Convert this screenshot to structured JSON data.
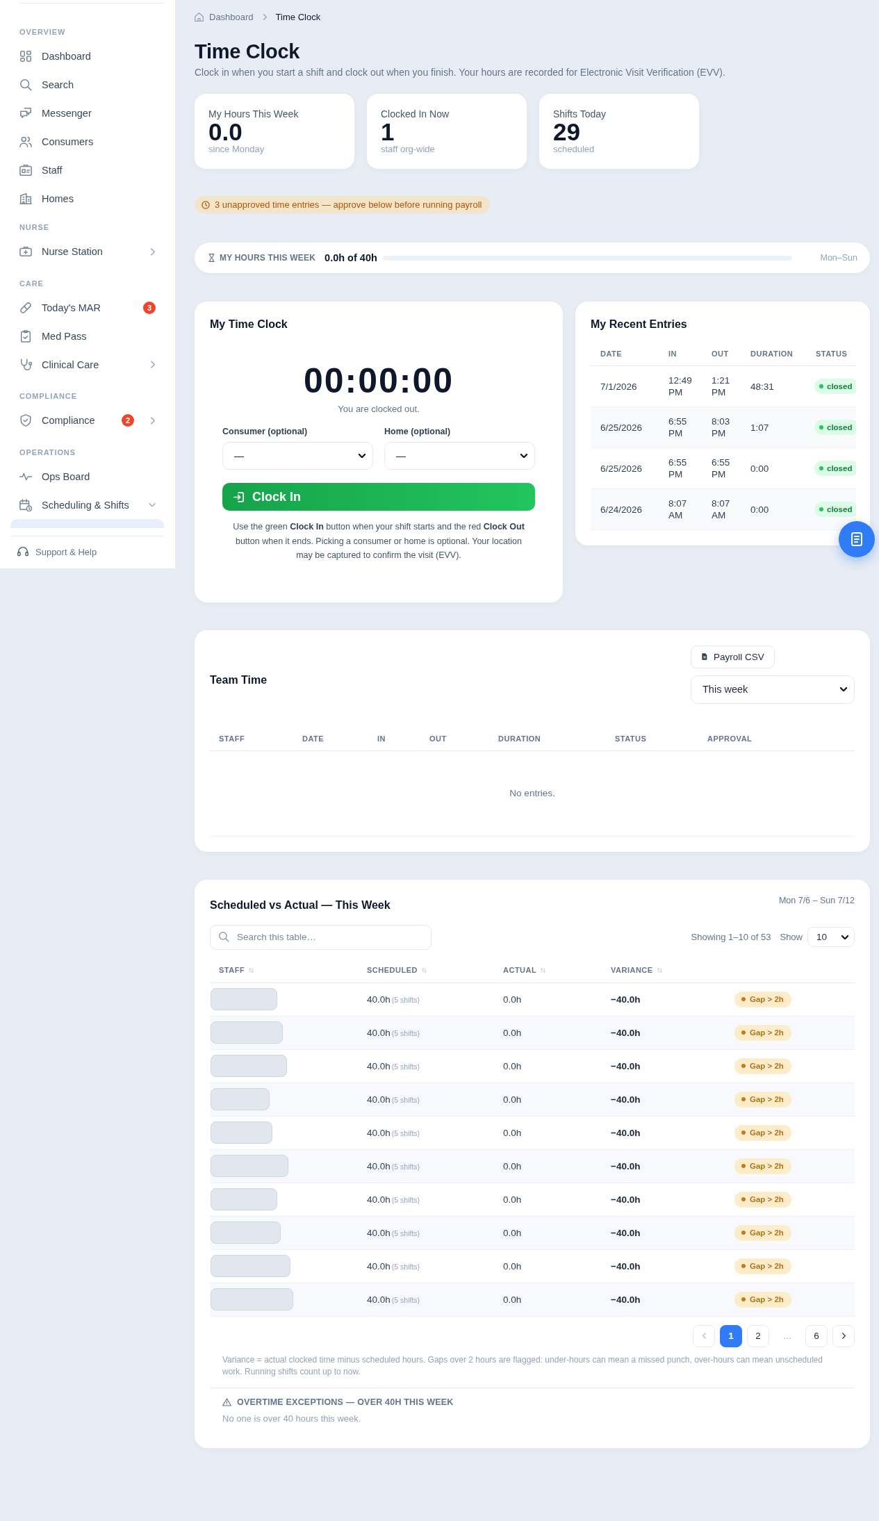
{
  "sidebar": {
    "sections": [
      {
        "heading": "OVERVIEW",
        "items": [
          {
            "label": "Dashboard",
            "selected": false
          },
          {
            "label": "Search",
            "selected": false
          },
          {
            "label": "Messenger",
            "selected": false
          },
          {
            "label": "Consumers",
            "selected": false
          },
          {
            "label": "Staff",
            "selected": false
          },
          {
            "label": "Homes",
            "selected": false
          }
        ]
      },
      {
        "heading": "NURSE",
        "items": [
          {
            "label": "Nurse Station",
            "selected": false,
            "expanded": false
          }
        ]
      },
      {
        "heading": "CARE",
        "items": [
          {
            "label": "Today's MAR",
            "selected": false,
            "badge": "3"
          },
          {
            "label": "Med Pass",
            "selected": false
          },
          {
            "label": "Clinical Care",
            "selected": false,
            "expanded": false
          }
        ]
      },
      {
        "heading": "COMPLIANCE",
        "items": [
          {
            "label": "Compliance",
            "selected": false,
            "badge": "2",
            "expanded": false
          }
        ]
      },
      {
        "heading": "OPERATIONS",
        "items": [
          {
            "label": "Ops Board",
            "selected": false
          },
          {
            "label": "Scheduling & Shifts",
            "selected": false,
            "expanded": true
          }
        ]
      }
    ],
    "clipped_item": {
      "selected": true
    },
    "footer": {
      "label": "Support & Help"
    }
  },
  "breadcrumb": [
    {
      "label": "Dashboard",
      "kind": "link"
    },
    {
      "label": "Time Clock",
      "kind": "current"
    }
  ],
  "page": {
    "title": "Time Clock",
    "subtitle": "Clock in when you start a shift and clock out when you finish. Your hours are recorded for Electronic Visit Verification (EVV)."
  },
  "stats": [
    {
      "label": "My Hours This Week",
      "value": "0.0",
      "caption": "since Monday"
    },
    {
      "label": "Clocked In Now",
      "value": "1",
      "caption": "staff org-wide"
    },
    {
      "label": "Shifts Today",
      "value": "29",
      "caption": "scheduled"
    }
  ],
  "alert": {
    "text": "3 unapproved time entries — approve below before running payroll"
  },
  "hours_bar": {
    "label": "MY HOURS THIS WEEK",
    "value": "0.0h of 40h",
    "level": 0,
    "range": "Mon–Sun"
  },
  "time_clock": {
    "title": "My Time Clock",
    "timer": "00:00:00",
    "status": "You are clocked out.",
    "fields": [
      {
        "label": "Consumer (optional)",
        "value": "—"
      },
      {
        "label": "Home (optional)",
        "value": "—"
      }
    ],
    "button": "Clock In",
    "help": "Use the green **Clock In** button when your shift starts and the red **Clock Out** button when it ends. Picking a consumer or home is optional. Your location may be captured to confirm the visit (EVV)."
  },
  "recent_entries": {
    "title": "My Recent Entries",
    "columns": [
      "DATE",
      "IN",
      "OUT",
      "DURATION",
      "STATUS"
    ],
    "rows": [
      {
        "date": "7/1/2026",
        "in": "12:49 PM",
        "out": "1:21 PM",
        "duration": "48:31",
        "status": "closed"
      },
      {
        "date": "6/25/2026",
        "in": "6:55 PM",
        "out": "8:03 PM",
        "duration": "1:07",
        "status": "closed"
      },
      {
        "date": "6/25/2026",
        "in": "6:55 PM",
        "out": "6:55 PM",
        "duration": "0:00",
        "status": "closed"
      },
      {
        "date": "6/24/2026",
        "in": "8:07 AM",
        "out": "8:07 AM",
        "duration": "0:00",
        "status": "closed"
      }
    ]
  },
  "team_time": {
    "title": "Team Time",
    "export_button": "Payroll CSV",
    "period": "This week",
    "columns": [
      "STAFF",
      "DATE",
      "IN",
      "OUT",
      "DURATION",
      "STATUS",
      "APPROVAL"
    ],
    "empty_text": "No entries."
  },
  "schedule": {
    "title": "Scheduled vs Actual — This Week",
    "date_range": "Mon 7/6 – Sun 7/12",
    "search": {
      "placeholder": "Search this table…"
    },
    "showing": "Showing 1–10 of 53",
    "show_label": "Show",
    "page_size": "10",
    "columns": [
      "STAFF",
      "SCHEDULED",
      "ACTUAL",
      "VARIANCE"
    ],
    "rows": [
      {
        "scheduled": "40.0h",
        "shifts": "(5 shifts)",
        "actual": "0.0h",
        "variance": "−40.0h",
        "flag": "Gap > 2h"
      },
      {
        "scheduled": "40.0h",
        "shifts": "(5 shifts)",
        "actual": "0.0h",
        "variance": "−40.0h",
        "flag": "Gap > 2h"
      },
      {
        "scheduled": "40.0h",
        "shifts": "(5 shifts)",
        "actual": "0.0h",
        "variance": "−40.0h",
        "flag": "Gap > 2h"
      },
      {
        "scheduled": "40.0h",
        "shifts": "(5 shifts)",
        "actual": "0.0h",
        "variance": "−40.0h",
        "flag": "Gap > 2h"
      },
      {
        "scheduled": "40.0h",
        "shifts": "(5 shifts)",
        "actual": "0.0h",
        "variance": "−40.0h",
        "flag": "Gap > 2h"
      },
      {
        "scheduled": "40.0h",
        "shifts": "(5 shifts)",
        "actual": "0.0h",
        "variance": "−40.0h",
        "flag": "Gap > 2h"
      },
      {
        "scheduled": "40.0h",
        "shifts": "(5 shifts)",
        "actual": "0.0h",
        "variance": "−40.0h",
        "flag": "Gap > 2h"
      },
      {
        "scheduled": "40.0h",
        "shifts": "(5 shifts)",
        "actual": "0.0h",
        "variance": "−40.0h",
        "flag": "Gap > 2h"
      },
      {
        "scheduled": "40.0h",
        "shifts": "(5 shifts)",
        "actual": "0.0h",
        "variance": "−40.0h",
        "flag": "Gap > 2h"
      },
      {
        "scheduled": "40.0h",
        "shifts": "(5 shifts)",
        "actual": "0.0h",
        "variance": "−40.0h",
        "flag": "Gap > 2h"
      }
    ],
    "pagination": {
      "pages": [
        {
          "kind": "page",
          "label": "1",
          "selected": true
        },
        {
          "kind": "page",
          "label": "2",
          "selected": false
        },
        {
          "kind": "ellipsis",
          "label": "…"
        },
        {
          "kind": "page",
          "label": "6",
          "selected": false
        }
      ]
    },
    "note": "Variance = actual clocked time minus scheduled hours. Gaps over 2 hours are flagged: under-hours can mean a missed punch, over-hours can mean unscheduled work. Running shifts count up to now.",
    "overtime": {
      "title": "OVERTIME EXCEPTIONS — OVER 40H THIS WEEK",
      "text": "No one is over 40 hours this week."
    }
  }
}
